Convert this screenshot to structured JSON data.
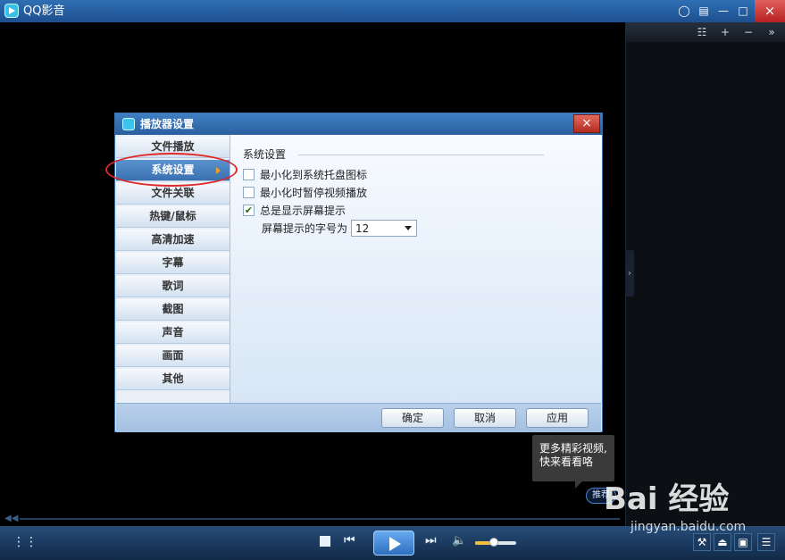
{
  "app": {
    "title": "QQ影音"
  },
  "titlebar": {
    "icons": [
      "chat-icon",
      "menu-icon",
      "minimize-icon",
      "maximize-icon"
    ],
    "close": "×"
  },
  "playlist": {
    "buttons": [
      "☷",
      "+",
      "−",
      "»"
    ],
    "expand": "›"
  },
  "dialog": {
    "title": "播放器设置",
    "close": "×",
    "sidebar": [
      {
        "label": "文件播放",
        "active": false
      },
      {
        "label": "系统设置",
        "active": true
      },
      {
        "label": "文件关联",
        "active": false
      },
      {
        "label": "热键/鼠标",
        "active": false
      },
      {
        "label": "高清加速",
        "active": false
      },
      {
        "label": "字幕",
        "active": false
      },
      {
        "label": "歌词",
        "active": false
      },
      {
        "label": "截图",
        "active": false
      },
      {
        "label": "声音",
        "active": false
      },
      {
        "label": "画面",
        "active": false
      },
      {
        "label": "其他",
        "active": false
      }
    ],
    "section_title": "系统设置",
    "options": [
      {
        "label": "最小化到系统托盘图标",
        "checked": false
      },
      {
        "label": "最小化时暂停视频播放",
        "checked": false
      },
      {
        "label": "总是显示屏幕提示",
        "checked": true
      }
    ],
    "font_size_label": "屏幕提示的字号为",
    "font_size_value": "12",
    "buttons": {
      "ok": "确定",
      "cancel": "取消",
      "apply": "应用"
    }
  },
  "tooltip": {
    "line1": "更多精彩视频,",
    "line2": "快来看看咯"
  },
  "recommend": "推荐",
  "player": {
    "seek_icon": "◀◀",
    "volume_level": 0.45
  },
  "watermark": {
    "brand": "Bai 经验",
    "url": "jingyan.baidu.com"
  },
  "colors": {
    "titlebar": "#1d4f8f",
    "accent": "#3a70b0",
    "highlight": "#e02828"
  }
}
